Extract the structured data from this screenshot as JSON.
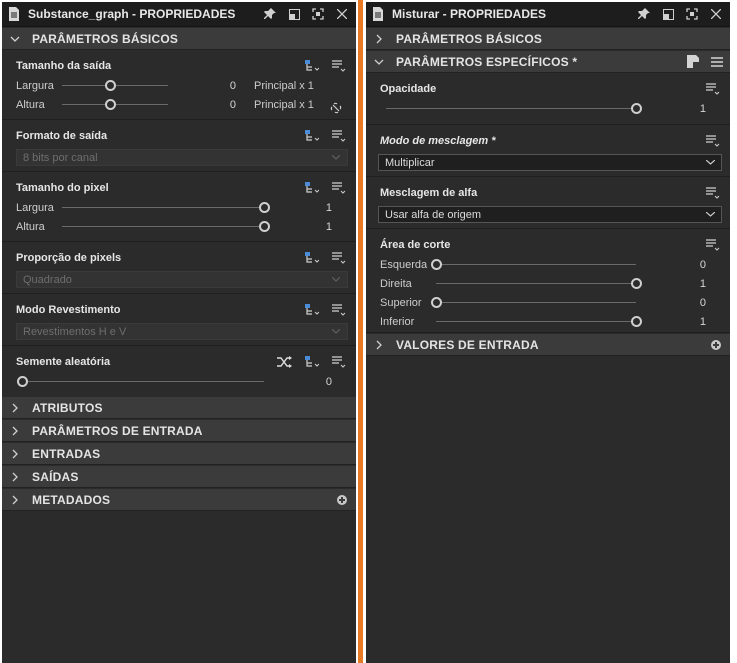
{
  "left": {
    "title": "Substance_graph - PROPRIEDADES",
    "basic_header": "PARÂMETROS BÁSICOS",
    "output_size": {
      "title": "Tamanho da saída",
      "width_label": "Largura",
      "width_value": "0",
      "width_suffix": "Principal x 1",
      "height_label": "Altura",
      "height_value": "0",
      "height_suffix": "Principal x 1",
      "width_fraction": 0.45,
      "height_fraction": 0.45
    },
    "output_format": {
      "title": "Formato de saída",
      "value": "8 bits por canal"
    },
    "pixel_size": {
      "title": "Tamanho do pixel",
      "width_label": "Largura",
      "width_value": "1",
      "height_label": "Altura",
      "height_value": "1",
      "width_fraction": 1.0,
      "height_fraction": 1.0
    },
    "pixel_ratio": {
      "title": "Proporção de pixels",
      "value": "Quadrado"
    },
    "tiling_mode": {
      "title": "Modo Revestimento",
      "value": "Revestimentos H e V"
    },
    "random_seed": {
      "title": "Semente aleatória",
      "value": "0",
      "fraction": 0.0
    },
    "sections": [
      "ATRIBUTOS",
      "PARÂMETROS DE ENTRADA",
      "ENTRADAS",
      "SAÍDAS",
      "METADADOS"
    ]
  },
  "right": {
    "title": "Misturar - PROPRIEDADES",
    "basic_header": "PARÂMETROS BÁSICOS",
    "specific_header": "PARÂMETROS ESPECÍFICOS *",
    "opacity": {
      "title": "Opacidade",
      "value": "1",
      "fraction": 1.0
    },
    "blend_mode": {
      "title": "Modo de mesclagem *",
      "value": "Multiplicar"
    },
    "alpha_blend": {
      "title": "Mesclagem de alfa",
      "value": "Usar alfa de origem"
    },
    "crop_area": {
      "title": "Área de corte",
      "rows": [
        {
          "label": "Esquerda",
          "value": "0",
          "fraction": 0.0
        },
        {
          "label": "Direita",
          "value": "1",
          "fraction": 1.0
        },
        {
          "label": "Superior",
          "value": "0",
          "fraction": 0.0
        },
        {
          "label": "Inferior",
          "value": "1",
          "fraction": 1.0
        }
      ]
    },
    "input_values_header": "VALORES DE ENTRADA"
  },
  "colors": {
    "accent_divider": "#e87a26",
    "panel_bg": "#2b2b2b",
    "section_bg": "#3b3b3b"
  }
}
